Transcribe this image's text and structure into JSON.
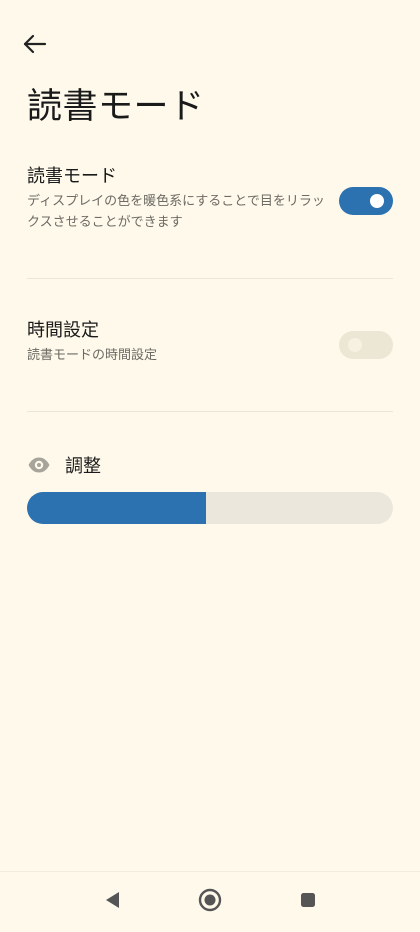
{
  "page": {
    "title": "読書モード"
  },
  "settings": {
    "reading_mode": {
      "title": "読書モード",
      "description": "ディスプレイの色を暖色系にすることで目をリラックスさせることができます",
      "enabled": true
    },
    "schedule": {
      "title": "時間設定",
      "description": "読書モードの時間設定",
      "enabled": false
    }
  },
  "adjust": {
    "label": "調整",
    "level_percent": 49
  },
  "colors": {
    "background": "#fef9ea",
    "accent": "#2c72b0",
    "track": "#ebe7dc"
  },
  "icons": {
    "back": "arrow-left-icon",
    "eye": "eye-icon",
    "nav_back": "triangle-back-icon",
    "nav_home": "circle-home-icon",
    "nav_recent": "square-recent-icon"
  }
}
